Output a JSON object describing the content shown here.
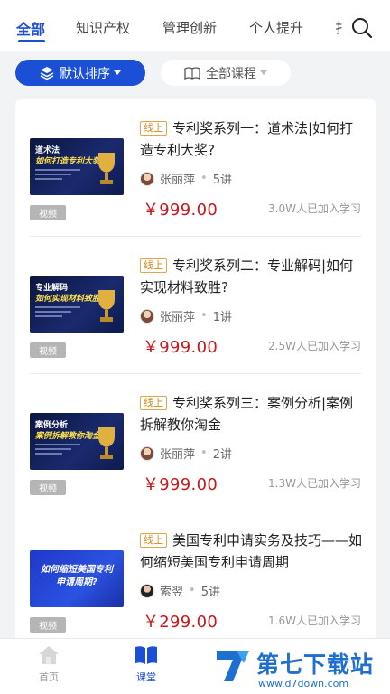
{
  "tabs": [
    {
      "label": "全部",
      "active": true
    },
    {
      "label": "知识产权",
      "active": false
    },
    {
      "label": "管理创新",
      "active": false
    },
    {
      "label": "个人提升",
      "active": false
    },
    {
      "label": "扌",
      "active": false
    }
  ],
  "filters": {
    "sort_label": "默认排序",
    "course_label": "全部课程"
  },
  "courses": [
    {
      "badge": "线上",
      "title": "专利奖系列一：道术法|如何打造专利大奖?",
      "teacher": "张丽萍",
      "lessons": "5讲",
      "price": "￥999.00",
      "learners": "3.0W人已加入学习",
      "media": "视频",
      "thumb_line1": "道术法",
      "thumb_line2": "如何打造专利大奖？"
    },
    {
      "badge": "线上",
      "title": "专利奖系列二：专业解码|如何实现材料致胜?",
      "teacher": "张丽萍",
      "lessons": "1讲",
      "price": "￥999.00",
      "learners": "2.5W人已加入学习",
      "media": "视频",
      "thumb_line1": "专业解码",
      "thumb_line2": "如何实现材料致胜？"
    },
    {
      "badge": "线上",
      "title": "专利奖系列三：案例分析|案例拆解教你淘金",
      "teacher": "张丽萍",
      "lessons": "2讲",
      "price": "￥999.00",
      "learners": "1.3W人已加入学习",
      "media": "视频",
      "thumb_line1": "案例分析",
      "thumb_line2": "案例拆解教你淘金"
    },
    {
      "badge": "线上",
      "title": "美国专利申请实务及技巧——如何缩短美国专利申请周期",
      "teacher": "索翌",
      "lessons": "5讲",
      "price": "￥299.00",
      "learners": "1.6W人已加入学习",
      "media": "视频",
      "thumb_line1": "如何缩短美国专利",
      "thumb_line2": "申请周期?"
    }
  ],
  "bottom_nav": [
    {
      "label": "首页",
      "icon": "home-icon",
      "active": false
    },
    {
      "label": "课堂",
      "icon": "book-icon",
      "active": true
    }
  ],
  "watermark": {
    "text": "第七下载站",
    "url": "www.d7down.com"
  },
  "colors": {
    "accent": "#1a4fd6",
    "price": "#c8161d",
    "badge": "#d38a1e"
  }
}
